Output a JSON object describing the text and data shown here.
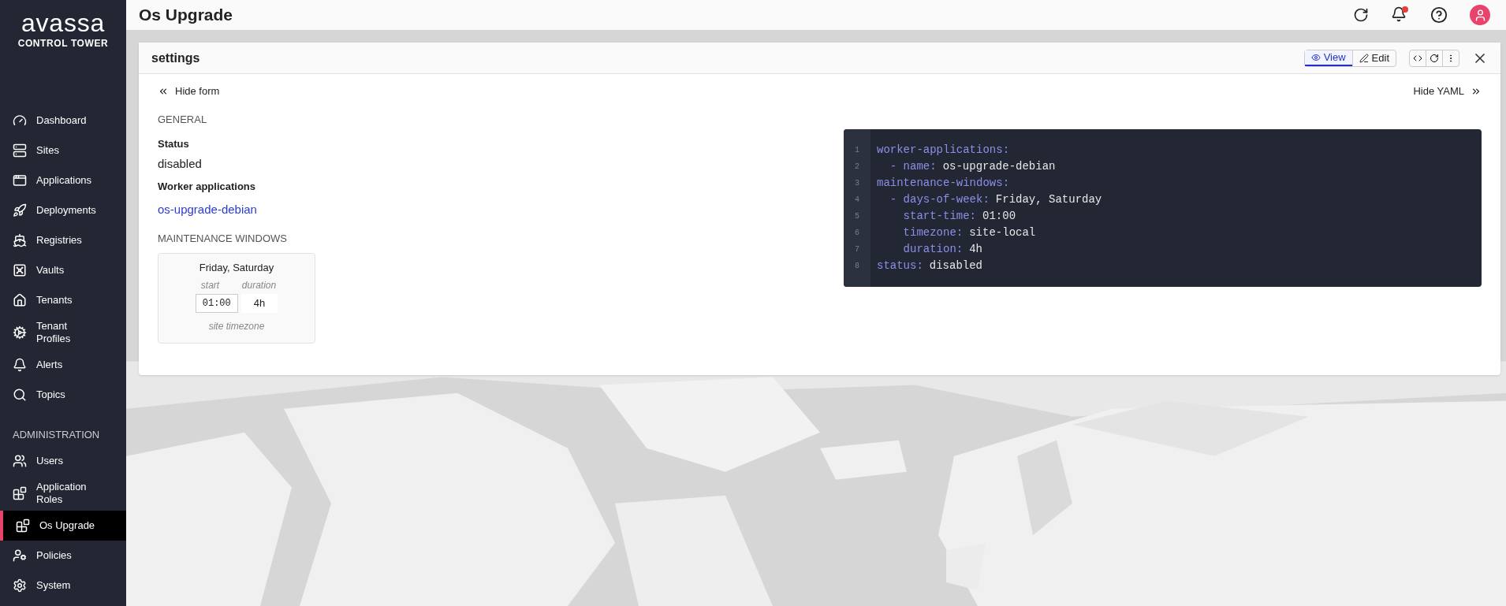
{
  "sidebar": {
    "logo": "avassa",
    "logo_subtitle": "CONTROL TOWER",
    "items": [
      {
        "label": "Dashboard",
        "selected": false
      },
      {
        "label": "Sites",
        "selected": false
      },
      {
        "label": "Applications",
        "selected": false
      },
      {
        "label": "Deployments",
        "selected": false
      },
      {
        "label": "Registries",
        "selected": false
      },
      {
        "label": "Vaults",
        "selected": false
      },
      {
        "label": "Tenants",
        "selected": false
      },
      {
        "label": "Tenant Profiles",
        "selected": false
      },
      {
        "label": "Alerts",
        "selected": false
      },
      {
        "label": "Topics",
        "selected": false
      }
    ],
    "section_title": "ADMINISTRATION",
    "admin_items": [
      {
        "label": "Users",
        "selected": false
      },
      {
        "label": "Application Roles",
        "selected": false
      },
      {
        "label": "Os Upgrade",
        "selected": true
      },
      {
        "label": "Policies",
        "selected": false
      },
      {
        "label": "System",
        "selected": false
      }
    ]
  },
  "header": {
    "title": "Os Upgrade",
    "notifications_unread": true
  },
  "panel": {
    "title": "settings",
    "modes": [
      {
        "label": "View",
        "selected": true
      },
      {
        "label": "Edit",
        "selected": false
      }
    ],
    "hide_form": "Hide form",
    "hide_yaml": "Hide YAML",
    "form": {
      "general_heading": "GENERAL",
      "status_label": "Status",
      "status_value": "disabled",
      "worker_label": "Worker applications",
      "worker_link": "os-upgrade-debian",
      "maintenance_heading": "MAINTENANCE WINDOWS",
      "window": {
        "days": "Friday, Saturday",
        "start_label": "start",
        "duration_label": "duration",
        "start": "01:00",
        "duration": "4h",
        "timezone": "site timezone"
      }
    },
    "yaml": [
      {
        "number": "1",
        "key": "worker-applications:"
      },
      {
        "number": "2",
        "key": "  - name:",
        "value": "os-upgrade-debian"
      },
      {
        "number": "3",
        "key": "maintenance-windows:"
      },
      {
        "number": "4",
        "key": "  - days-of-week:",
        "value": "Friday, Saturday"
      },
      {
        "number": "5",
        "key": "    start-time:",
        "value": "01:00"
      },
      {
        "number": "6",
        "key": "    timezone:",
        "value": "site-local"
      },
      {
        "number": "7",
        "key": "    duration:",
        "value": "4h"
      },
      {
        "number": "8",
        "key": "status:",
        "value": "disabled"
      }
    ]
  }
}
